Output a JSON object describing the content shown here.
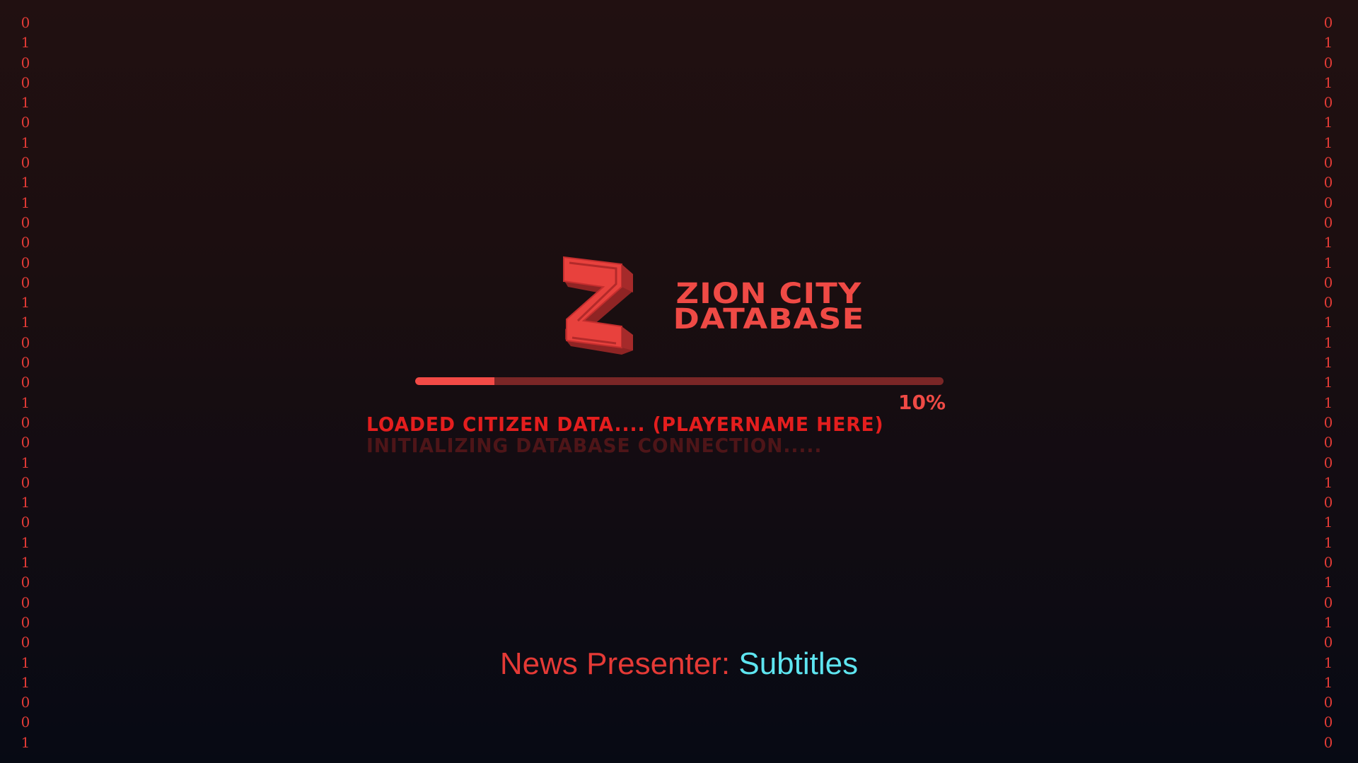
{
  "binary_left": [
    "0",
    "1",
    "0",
    "0",
    "1",
    "0",
    "1",
    "0",
    "1",
    "1",
    "0",
    "0",
    "0",
    "0",
    "1",
    "1",
    "0",
    "0",
    "0",
    "1",
    "0",
    "0",
    "1",
    "0",
    "1",
    "0",
    "1",
    "1",
    "0",
    "0",
    "0",
    "0",
    "1",
    "1",
    "0",
    "0",
    "1"
  ],
  "binary_right": [
    "0",
    "1",
    "0",
    "1",
    "0",
    "1",
    "1",
    "0",
    "0",
    "0",
    "0",
    "1",
    "1",
    "0",
    "0",
    "1",
    "1",
    "1",
    "1",
    "1",
    "0",
    "0",
    "0",
    "1",
    "0",
    "1",
    "1",
    "0",
    "1",
    "0",
    "1",
    "0",
    "1",
    "1",
    "0",
    "0",
    "0"
  ],
  "loading": {
    "title": "ZION CITY DATABASE",
    "progress": 0.15,
    "percent_label": "10%",
    "status_current": "LOADED CITIZEN DATA.... (PLAYERNAME HERE)",
    "status_previous": "INITIALIZING DATABASE CONNECTION....."
  },
  "subtitles": {
    "speaker": "News Presenter:",
    "line": "Subtitles"
  },
  "colors": {
    "accent": "#ef4a45",
    "track": "#7a2626",
    "subtitle_text": "#5ee5f0"
  },
  "icons": {
    "logo": "zion-z-logo"
  }
}
